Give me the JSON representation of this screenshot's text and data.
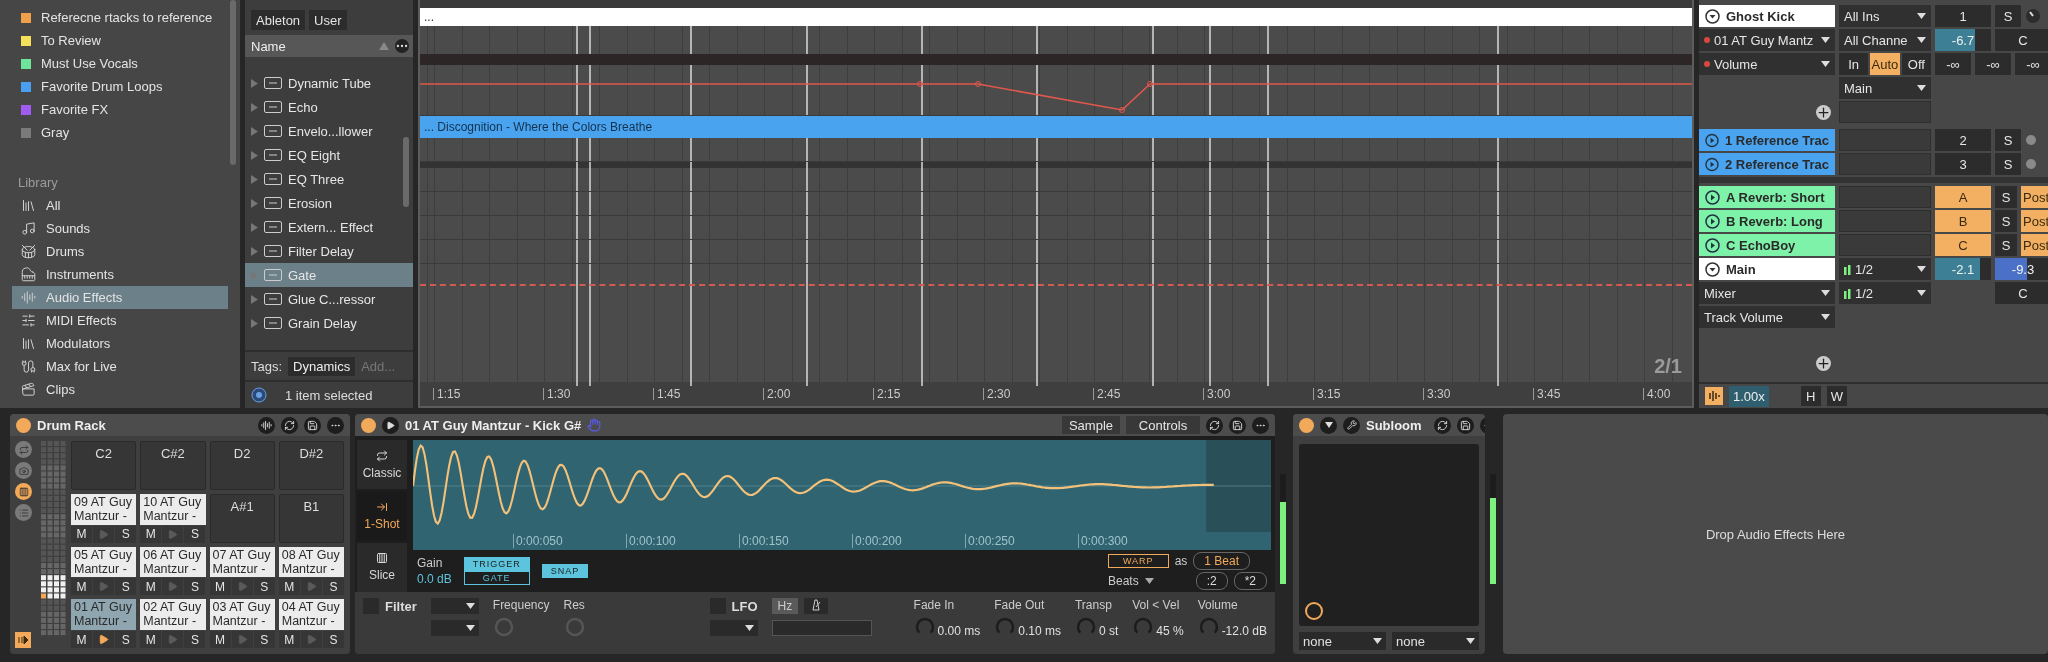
{
  "collections": [
    {
      "label": "Referecne rtacks to reference",
      "color": "#f0a04b"
    },
    {
      "label": "To Review",
      "color": "#f5e05a"
    },
    {
      "label": "Must Use Vocals",
      "color": "#6ee59a"
    },
    {
      "label": "Favorite Drum Loops",
      "color": "#4a9ff0"
    },
    {
      "label": "Favorite FX",
      "color": "#a05cf0"
    },
    {
      "label": "Gray",
      "color": "#7a7a7a"
    }
  ],
  "library": {
    "title": "Library",
    "items": [
      {
        "label": "All",
        "kind": "all",
        "selected": false
      },
      {
        "label": "Sounds",
        "kind": "sounds",
        "selected": false
      },
      {
        "label": "Drums",
        "kind": "drums",
        "selected": false
      },
      {
        "label": "Instruments",
        "kind": "instruments",
        "selected": false
      },
      {
        "label": "Audio Effects",
        "kind": "audio",
        "selected": true
      },
      {
        "label": "MIDI Effects",
        "kind": "midi",
        "selected": false
      },
      {
        "label": "Modulators",
        "kind": "modulators",
        "selected": false
      },
      {
        "label": "Max for Live",
        "kind": "max",
        "selected": false
      },
      {
        "label": "Clips",
        "kind": "clips",
        "selected": false
      }
    ]
  },
  "browser": {
    "filters": [
      "Ableton",
      "User"
    ],
    "column": "Name",
    "items": [
      {
        "label": "Dynamic Tube",
        "selected": false
      },
      {
        "label": "Echo",
        "selected": false
      },
      {
        "label": "Envelo...llower",
        "selected": false
      },
      {
        "label": "EQ Eight",
        "selected": false
      },
      {
        "label": "EQ Three",
        "selected": false
      },
      {
        "label": "Erosion",
        "selected": false
      },
      {
        "label": "Extern... Effect",
        "selected": false
      },
      {
        "label": "Filter Delay",
        "selected": false
      },
      {
        "label": "Gate",
        "selected": true
      },
      {
        "label": "Glue C...ressor",
        "selected": false
      },
      {
        "label": "Grain Delay",
        "selected": false
      }
    ],
    "tags_label": "Tags:",
    "tag": "Dynamics",
    "tag_add": "Add...",
    "status": "1 item selected"
  },
  "arrangement": {
    "strip": "...",
    "clip": "... Discognition - Where the Colors Breathe",
    "page": "2/1",
    "ruler": [
      "1:15",
      "1:30",
      "1:45",
      "2:00",
      "2:15",
      "2:30",
      "2:45",
      "3:00",
      "3:15",
      "3:30",
      "3:45",
      "4:00"
    ]
  },
  "mixer": {
    "tracks": [
      {
        "kind": "midi",
        "name": "Ghost Kick",
        "color": "#ffffff",
        "device": "01 AT Guy Mantz",
        "parameter": "Volume",
        "input": "All Ins",
        "channel": "All Channe",
        "monitor": [
          {
            "label": "In",
            "selected": false
          },
          {
            "label": "Auto",
            "selected": true
          },
          {
            "label": "Off",
            "selected": false
          }
        ],
        "output": "Main",
        "number": "1",
        "solo": "S",
        "volume": {
          "reading": "-6.7",
          "level": 0.72
        },
        "pan": "C",
        "sends": [
          "-∞",
          "-∞",
          "-∞"
        ]
      },
      {
        "kind": "audio",
        "name": "1 Reference Trac",
        "color": "#4aa3ee",
        "number": "2",
        "solo": "S"
      },
      {
        "kind": "audio",
        "name": "2 Reference Trac",
        "color": "#4aa3ee",
        "number": "3",
        "solo": "S"
      },
      {
        "kind": "return",
        "name": "A Reverb: Short",
        "color": "#7ef2a8",
        "number": "A",
        "solo": "S",
        "mode": "Post"
      },
      {
        "kind": "return",
        "name": "B Reverb: Long",
        "color": "#7ef2a8",
        "number": "B",
        "solo": "S",
        "mode": "Post"
      },
      {
        "kind": "return",
        "name": "C EchoBoy",
        "color": "#7ef2a8",
        "number": "C",
        "solo": "S",
        "mode": "Post"
      },
      {
        "kind": "main",
        "name": "Main",
        "color": "#ffffff",
        "device": "Mixer",
        "parameter": "Track Volume",
        "output": "1/2",
        "output_2": "1/2",
        "volume": {
          "reading": "-2.1",
          "level": 0.8
        },
        "volume_2": {
          "reading": "-9.3",
          "level": 0.58
        },
        "pan": "C"
      }
    ],
    "zoom": "1.00x",
    "buttons": [
      "H",
      "W"
    ]
  },
  "drum_rack": {
    "title": "Drum Rack",
    "pads": [
      {
        "kind": "empty",
        "note": "C2"
      },
      {
        "kind": "empty",
        "note": "C#2"
      },
      {
        "kind": "empty",
        "note": "D2"
      },
      {
        "kind": "empty",
        "note": "D#2"
      },
      {
        "kind": "sample",
        "name": "09 AT Guy Mantzur -",
        "mute": "M",
        "solo": "S",
        "selected": false
      },
      {
        "kind": "sample",
        "name": "10 AT Guy Mantzur -",
        "mute": "M",
        "solo": "S",
        "selected": false
      },
      {
        "kind": "empty",
        "note": "A#1"
      },
      {
        "kind": "empty",
        "note": "B1"
      },
      {
        "kind": "sample",
        "name": "05 AT Guy Mantzur -",
        "mute": "M",
        "solo": "S",
        "selected": false
      },
      {
        "kind": "sample",
        "name": "06 AT Guy Mantzur -",
        "mute": "M",
        "solo": "S",
        "selected": false
      },
      {
        "kind": "sample",
        "name": "07 AT Guy Mantzur -",
        "mute": "M",
        "solo": "S",
        "selected": false
      },
      {
        "kind": "sample",
        "name": "08 AT Guy Mantzur -",
        "mute": "M",
        "solo": "S",
        "selected": false
      },
      {
        "kind": "sample",
        "name": "01 AT Guy Mantzur -",
        "mute": "M",
        "solo": "S",
        "selected": true
      },
      {
        "kind": "sample",
        "name": "02 AT Guy Mantzur -",
        "mute": "M",
        "solo": "S",
        "selected": false
      },
      {
        "kind": "sample",
        "name": "03 AT Guy Mantzur -",
        "mute": "M",
        "solo": "S",
        "selected": false
      },
      {
        "kind": "sample",
        "name": "04 AT Guy Mantzur -",
        "mute": "M",
        "solo": "S",
        "selected": false
      }
    ]
  },
  "sampler": {
    "title": "01 AT Guy Mantzur - Kick G#",
    "views": [
      "Sample",
      "Controls"
    ],
    "modes": [
      {
        "label": "Classic",
        "kind": "classic",
        "selected": false
      },
      {
        "label": "1-Shot",
        "kind": "oneshot",
        "selected": true
      },
      {
        "label": "Slice",
        "kind": "slice",
        "selected": false
      }
    ],
    "times": [
      "0:00:050",
      "0:00:100",
      "0:00:150",
      "0:00:200",
      "0:00:250",
      "0:00:300"
    ],
    "gain_label": "Gain",
    "gain": "0.0 dB",
    "trigger": [
      {
        "label": "TRIGGER",
        "selected": true
      },
      {
        "label": "GATE",
        "selected": false
      }
    ],
    "snap": "SNAP",
    "warp": "WARP",
    "as": "as",
    "beat": "1 Beat",
    "beats": "Beats",
    "halve": ":2",
    "double": "*2",
    "filter": {
      "label": "Filter",
      "on": false
    },
    "frequency": "Frequency",
    "res": "Res",
    "lfo": {
      "label": "LFO",
      "on": false
    },
    "hz": "Hz",
    "knobs": [
      {
        "label": "Fade In",
        "value": "0.00 ms"
      },
      {
        "label": "Fade Out",
        "value": "0.10 ms"
      },
      {
        "label": "Transp",
        "value": "0 st"
      },
      {
        "label": "Vol < Vel",
        "value": "45 %"
      },
      {
        "label": "Volume",
        "value": "-12.0 dB"
      }
    ]
  },
  "subloom": {
    "title": "Subloom",
    "selectors": [
      "none",
      "none"
    ]
  },
  "drop_zone": "Drop Audio Effects Here"
}
